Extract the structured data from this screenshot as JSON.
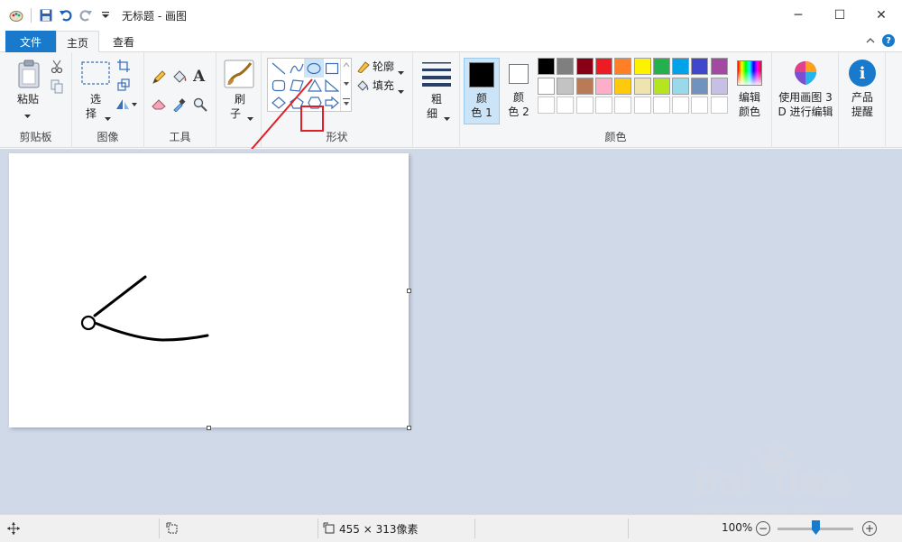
{
  "window": {
    "title": "无标题 - 画图",
    "controls": {
      "minimize": "─",
      "maximize": "☐",
      "close": "✕"
    }
  },
  "tabs": {
    "file": "文件",
    "home": "主页",
    "view": "查看"
  },
  "ribbon": {
    "clipboard": {
      "paste": "粘贴",
      "group_label": "剪贴板"
    },
    "image": {
      "select_1": "选",
      "select_2": "择",
      "group_label": "图像"
    },
    "tools": {
      "group_label": "工具",
      "text_glyph": "A"
    },
    "brushes": {
      "label_1": "刷",
      "label_2": "子"
    },
    "shapes": {
      "outline": "轮廓",
      "fill": "填充",
      "group_label": "形状"
    },
    "size": {
      "label_1": "粗",
      "label_2": "细"
    },
    "colors": {
      "color1_1": "颜",
      "color1_2": "色 1",
      "color2_1": "颜",
      "color2_2": "色 2",
      "edit_1": "编辑",
      "edit_2": "颜色",
      "group_label": "颜色",
      "color1_value": "#000000",
      "color2_value": "#ffffff",
      "palette_row1": [
        "#000000",
        "#7f7f7f",
        "#880015",
        "#ed1c24",
        "#ff7f27",
        "#fff200",
        "#22b14c",
        "#00a2e8",
        "#3f48cc",
        "#a349a4"
      ],
      "palette_row2": [
        "#ffffff",
        "#c3c3c3",
        "#b97a57",
        "#ffaec9",
        "#ffc90e",
        "#efe4b0",
        "#b5e61d",
        "#99d9ea",
        "#7092be",
        "#c8bfe7"
      ]
    },
    "paint3d": {
      "label_1": "使用画图 3",
      "label_2": "D 进行编辑"
    },
    "product_alert": {
      "label_1": "产品",
      "label_2": "提醒"
    }
  },
  "statusbar": {
    "canvas_size": "455 × 313像素",
    "zoom": "100%"
  },
  "watermark": {
    "brand": "Bai",
    "brand2": "du",
    "suffix": "经验",
    "url": "jingyan.baidu.com"
  },
  "accent": "#1979ca",
  "highlight": "#e21f26"
}
